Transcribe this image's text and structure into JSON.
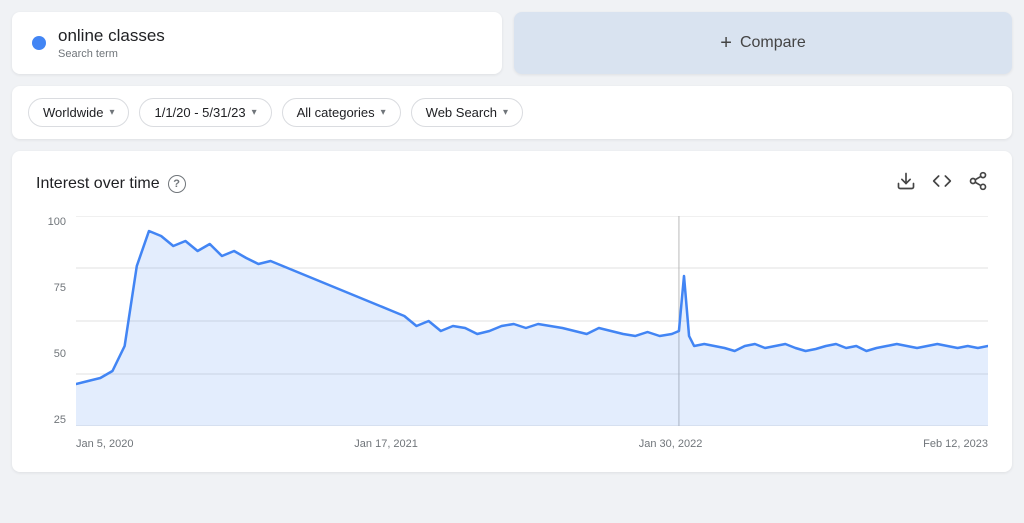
{
  "search_term": {
    "label": "online classes",
    "sublabel": "Search term",
    "dot_color": "#4285f4"
  },
  "compare": {
    "plus": "+",
    "label": "Compare"
  },
  "filters": {
    "location": {
      "label": "Worldwide",
      "chevron": "▾"
    },
    "date_range": {
      "label": "1/1/20 - 5/31/23",
      "chevron": "▾"
    },
    "category": {
      "label": "All categories",
      "chevron": "▾"
    },
    "search_type": {
      "label": "Web Search",
      "chevron": "▾"
    }
  },
  "chart": {
    "title": "Interest over time",
    "help_tooltip": "?",
    "y_labels": [
      "100",
      "75",
      "50",
      "25"
    ],
    "x_labels": [
      "Jan 5, 2020",
      "Jan 17, 2021",
      "Jan 30, 2022",
      "Feb 12, 2023"
    ],
    "download_icon": "⬇",
    "code_icon": "<>",
    "share_icon": "⋮"
  }
}
